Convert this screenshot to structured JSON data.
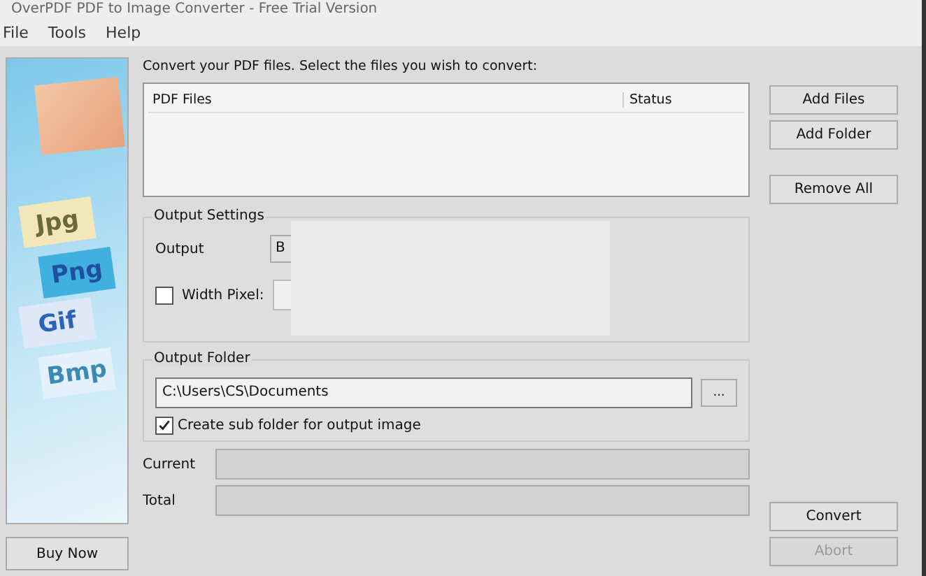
{
  "window": {
    "title": "OverPDF PDF to Image Converter - Free Trial Version"
  },
  "menu": [
    "File",
    "Tools",
    "Help"
  ],
  "banner": {
    "labels": [
      "Jpg",
      "Png",
      "Gif",
      "Bmp"
    ]
  },
  "buy_button": "Buy Now",
  "instruction": "Convert your PDF files. Select the files you wish to convert:",
  "file_list": {
    "columns": [
      "PDF Files",
      "Status"
    ]
  },
  "list_buttons": [
    "Add Files",
    "Add Folder",
    "Remove All"
  ],
  "output_settings": {
    "title": "Output Settings",
    "output_label": "Output",
    "output_value": "B",
    "width_pixel": {
      "label": "Width Pixel:",
      "checked": false
    }
  },
  "output_folder": {
    "title": "Output Folder",
    "path": "C:\\Users\\CS\\Documents",
    "browse": "...",
    "subfolder": {
      "label": "Create sub folder for output image",
      "checked": true
    }
  },
  "progress": [
    {
      "label": "Current",
      "level": 0
    },
    {
      "label": "Total",
      "level": 0
    }
  ],
  "action_buttons": [
    {
      "label": "Convert",
      "disabled": false
    },
    {
      "label": "Abort",
      "disabled": true
    }
  ]
}
